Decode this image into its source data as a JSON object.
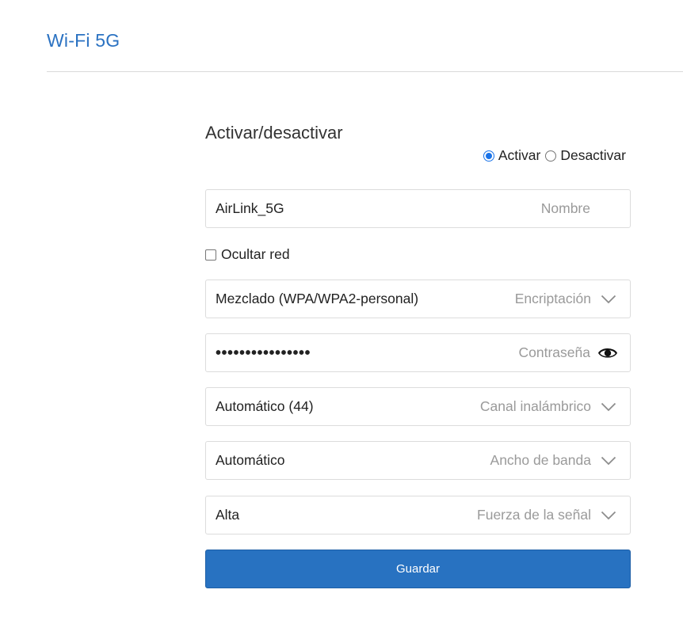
{
  "header": {
    "title": "Wi-Fi 5G"
  },
  "section": {
    "title": "Activar/desactivar",
    "radio_on_label": "Activar",
    "radio_off_label": "Desactivar",
    "selected": "Activar"
  },
  "fields": {
    "name": {
      "value": "AirLink_5G",
      "hint": "Nombre"
    },
    "hide_network": {
      "label": "Ocultar red",
      "checked": false
    },
    "encryption": {
      "value": "Mezclado (WPA/WPA2-personal)",
      "hint": "Encriptación",
      "icon": "chevron-down-icon"
    },
    "password": {
      "value": "••••••••••••••••",
      "hint": "Contraseña",
      "icon": "eye-icon"
    },
    "channel": {
      "value": "Automático (44)",
      "hint": "Canal inalámbrico",
      "icon": "chevron-down-icon"
    },
    "bandwidth": {
      "value": "Automático",
      "hint": "Ancho de banda",
      "icon": "chevron-down-icon"
    },
    "signal": {
      "value": "Alta",
      "hint": "Fuerza de la señal",
      "icon": "chevron-down-icon"
    }
  },
  "actions": {
    "save_label": "Guardar"
  },
  "colors": {
    "accent": "#2872c1",
    "title": "#2b72c2",
    "radio": "#1a73e8"
  }
}
